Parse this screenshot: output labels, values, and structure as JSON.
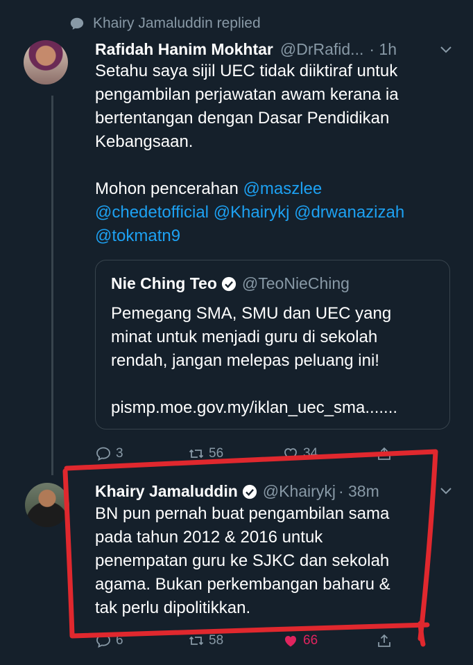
{
  "reply_context": {
    "text": "Khairy Jamaluddin replied"
  },
  "tweet1": {
    "name": "Rafidah Hanim Mokhtar",
    "handle": "@DrRafid...",
    "time": "· 1h",
    "text_lines": [
      "Setahu saya sijil UEC tidak diiktiraf untuk",
      "pengambilan perjawatan awam kerana ia",
      "bertentangan dengan Dasar Pendidikan",
      "Kebangsaan."
    ],
    "request": "Mohon pencerahan",
    "mentions": [
      "@maszlee",
      "@chedetofficial",
      "@Khairykj",
      "@drwanazizah",
      "@tokmatn9"
    ],
    "quote": {
      "name": "Nie Ching Teo",
      "handle": "@TeoNieChing",
      "text_lines": [
        "Pemegang SMA, SMU dan UEC yang",
        "minat untuk menjadi guru di sekolah",
        "rendah, jangan melepas peluang ini!"
      ],
      "link": "pismp.moe.gov.my/iklan_uec_sma......."
    },
    "actions": {
      "replies": "3",
      "retweets": "56",
      "likes": "34"
    }
  },
  "tweet2": {
    "name": "Khairy Jamaluddin",
    "handle": "@Khairykj",
    "time": "· 38m",
    "text_lines": [
      "BN pun pernah buat pengambilan sama",
      "pada tahun 2012 & 2016 untuk",
      "penempatan guru ke SJKC dan sekolah",
      "agama. Bukan perkembangan baharu &",
      "tak perlu dipolitikkan."
    ],
    "actions": {
      "replies": "6",
      "retweets": "58",
      "likes": "66"
    }
  },
  "colors": {
    "background": "#15202b",
    "secondary": "#8899a6",
    "link": "#1da1f2",
    "like": "#e0245e",
    "annotation": "#e0282e"
  }
}
